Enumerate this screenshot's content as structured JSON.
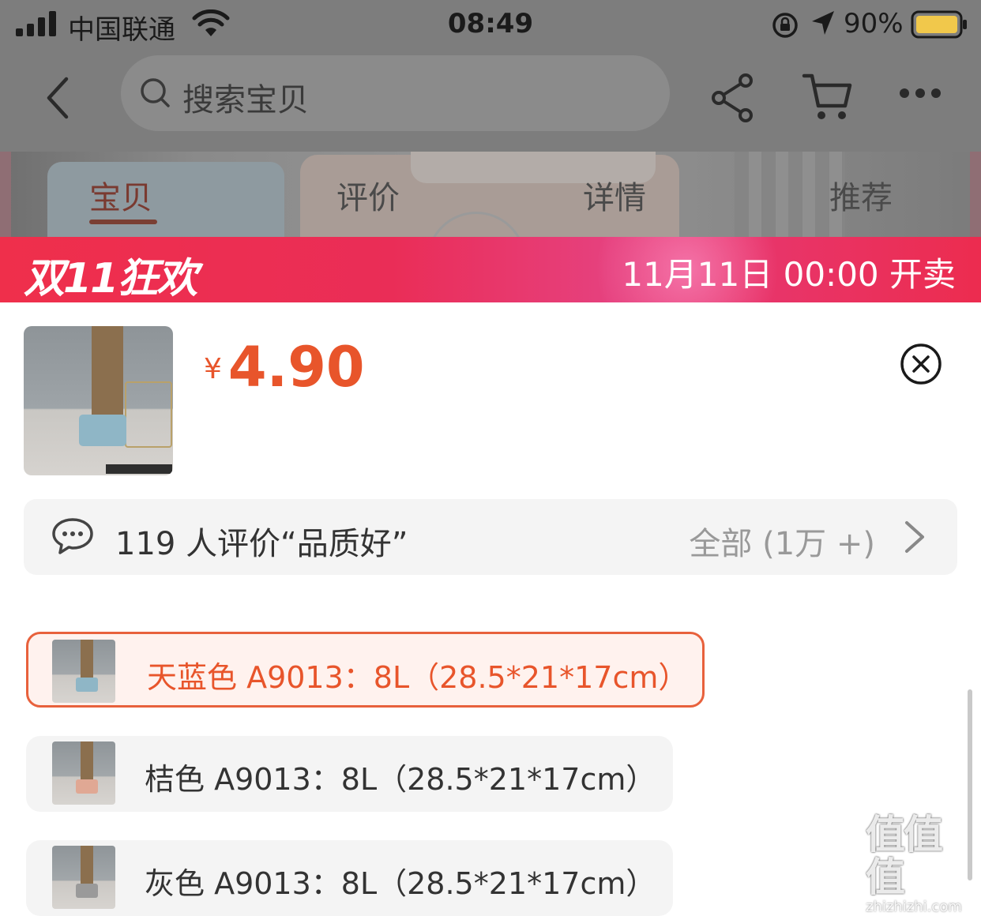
{
  "status_bar": {
    "carrier": "中国联通",
    "time": "08:49",
    "battery_percent": "90%"
  },
  "nav": {
    "search_placeholder": "搜索宝贝"
  },
  "tabs": [
    "宝贝",
    "评价",
    "详情",
    "推荐"
  ],
  "promo": {
    "logo": "双11狂欢",
    "date_text": "11月11日 00:00 开卖"
  },
  "product": {
    "currency": "¥",
    "price": "4.90"
  },
  "review": {
    "text": "119 人评价“品质好”",
    "all": "全部 (1万 +)"
  },
  "skus": [
    {
      "label": "天蓝色 A9013：8L（28.5*21*17cm）",
      "selected": true,
      "box_color": "#8fb6c6"
    },
    {
      "label": "桔色 A9013：8L（28.5*21*17cm）",
      "selected": false,
      "box_color": "#e0a894"
    },
    {
      "label": "灰色 A9013：8L（28.5*21*17cm）",
      "selected": false,
      "box_color": "#9a9a9a"
    }
  ],
  "watermark": {
    "big": "值值值",
    "small": "zhizhizhi.com"
  },
  "colors": {
    "accent": "#e8552b",
    "promo_red": "#ec2c4f"
  }
}
